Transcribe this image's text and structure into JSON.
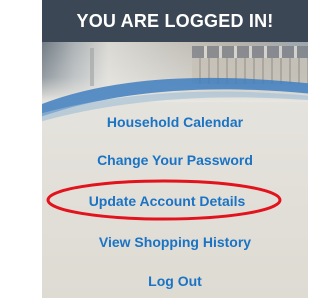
{
  "header": {
    "title": "YOU ARE LOGGED IN!",
    "background_color": "#3b4755",
    "text_color": "#ffffff"
  },
  "menu": {
    "link_color": "#1a73c4",
    "items": [
      {
        "label": "Household Calendar"
      },
      {
        "label": "Change Your Password"
      },
      {
        "label": "Update Account Details",
        "highlighted": true
      },
      {
        "label": "View Shopping History"
      },
      {
        "label": "Log Out"
      }
    ]
  },
  "annotation": {
    "shape": "ellipse",
    "color": "#e2131c"
  }
}
